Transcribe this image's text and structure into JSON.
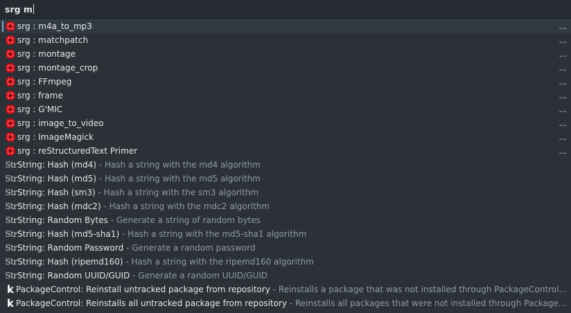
{
  "search": {
    "value": "srg m"
  },
  "srg_items": [
    {
      "label": "srg : m4a_to_mp3",
      "more": "...",
      "selected": true
    },
    {
      "label": "srg : matchpatch",
      "more": "..."
    },
    {
      "label": "srg : montage",
      "more": "..."
    },
    {
      "label": "srg : montage_crop",
      "more": "..."
    },
    {
      "label": "srg : FFmpeg",
      "more": "..."
    },
    {
      "label": "srg : frame",
      "more": "..."
    },
    {
      "label": "srg : G'MIC",
      "more": "..."
    },
    {
      "label": "srg : image_to_video",
      "more": "..."
    },
    {
      "label": "srg : ImageMagick",
      "more": "..."
    },
    {
      "label": "srg : reStructuredText Primer",
      "more": "..."
    }
  ],
  "string_icon": "Str",
  "string_items": [
    {
      "title": "String: Hash (md4)",
      "desc": "Hash a string with the md4 algorithm"
    },
    {
      "title": "String: Hash (md5)",
      "desc": "Hash a string with the md5 algorithm"
    },
    {
      "title": "String: Hash (sm3)",
      "desc": "Hash a string with the sm3 algorithm"
    },
    {
      "title": "String: Hash (mdc2)",
      "desc": "Hash a string with the mdc2 algorithm"
    },
    {
      "title": "String: Random Bytes",
      "desc": "Generate a string of random bytes"
    },
    {
      "title": "String: Hash (md5-sha1)",
      "desc": "Hash a string with the md5-sha1 algorithm"
    },
    {
      "title": "String: Random Password",
      "desc": "Generate a random password"
    },
    {
      "title": "String: Hash (ripemd160)",
      "desc": "Hash a string with the ripemd160 algorithm"
    },
    {
      "title": "String: Random UUID/GUID",
      "desc": "Generate a random UUID/GUID"
    }
  ],
  "package_icon": "k",
  "package_items": [
    {
      "title": "PackageControl: Reinstall untracked package from repository",
      "desc": "Reinstalls a package that was not installed through PackageControl from t..."
    },
    {
      "title": "PackageControl: Reinstalls all untracked package from repository",
      "desc": "Reinstalls all packages that were not installed through PackageContro..."
    }
  ],
  "separator": " - ",
  "colors": {
    "background": "#2b3137",
    "title": "#e4e8ea",
    "description": "#8f9ba6",
    "srg_icon": "#c0101a"
  }
}
